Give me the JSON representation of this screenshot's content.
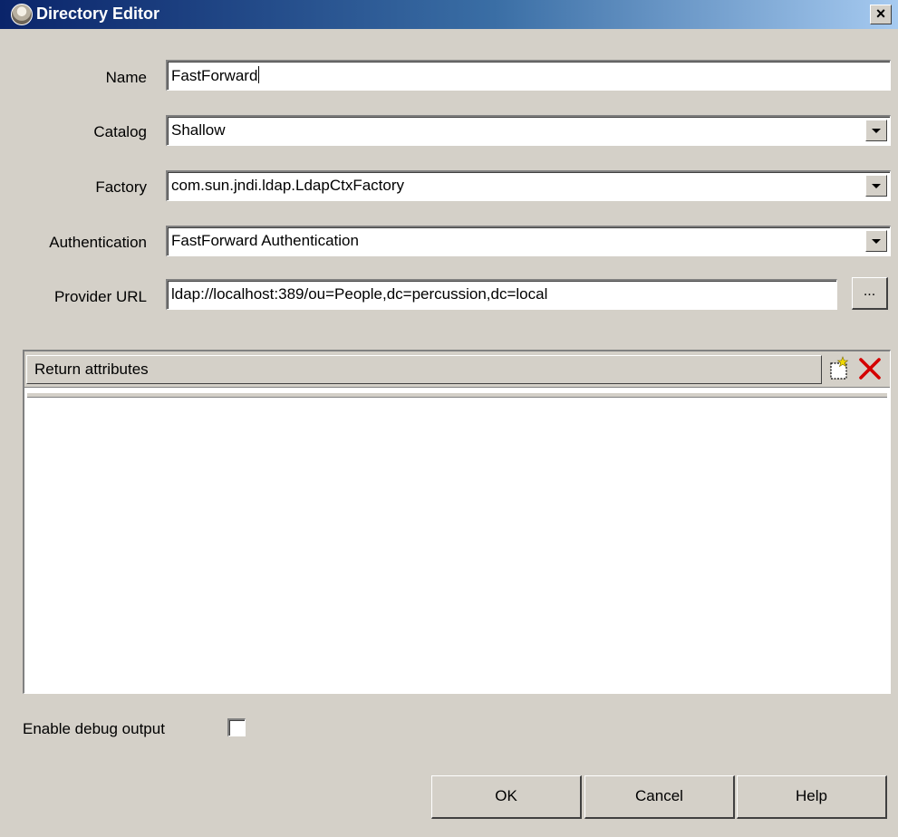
{
  "window": {
    "title": "Directory Editor",
    "close_label": "×",
    "icon": "app-icon"
  },
  "form": {
    "name_label": "Name",
    "name_value": "FastForward",
    "catalog_label": "Catalog",
    "catalog_value": "Shallow",
    "factory_label": "Factory",
    "factory_value": "com.sun.jndi.ldap.LdapCtxFactory",
    "authentication_label": "Authentication",
    "authentication_value": "FastForward Authentication",
    "provider_url_label": "Provider URL",
    "provider_url_value": "ldap://localhost:389/ou=People,dc=percussion,dc=local",
    "browse_label": "..."
  },
  "attributes_table": {
    "header": "Return attributes",
    "add_icon": "new-row-icon",
    "delete_icon": "delete-x-icon",
    "rows": []
  },
  "debug": {
    "label": "Enable debug output",
    "checked": false
  },
  "buttons": {
    "ok": "OK",
    "cancel": "Cancel",
    "help": "Help"
  },
  "colors": {
    "dialog_bg": "#d4d0c8",
    "title_start": "#0a246a",
    "title_end": "#a6caf0",
    "delete_red": "#d40000"
  }
}
